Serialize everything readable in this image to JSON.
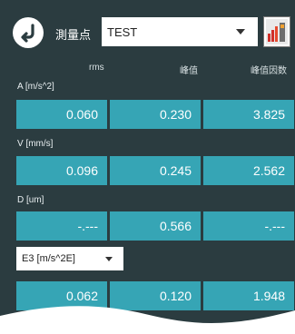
{
  "header": {
    "point_label": "測量点",
    "point_value": "TEST"
  },
  "columns": [
    "rms",
    "峰值",
    "峰值因数"
  ],
  "rows": [
    {
      "label": "A [m/s^2]",
      "values": [
        "0.060",
        "0.230",
        "3.825"
      ]
    },
    {
      "label": "V [mm/s]",
      "values": [
        "0.096",
        "0.245",
        "2.562"
      ]
    },
    {
      "label": "D [um]",
      "values": [
        "-.---",
        "0.566",
        "-.---"
      ]
    }
  ],
  "e3": {
    "selector_value": "E3 [m/s^2E]",
    "values": [
      "0.062",
      "0.120",
      "1.948"
    ]
  },
  "colors": {
    "background": "#2b3c40",
    "cell": "#36a5b5"
  }
}
